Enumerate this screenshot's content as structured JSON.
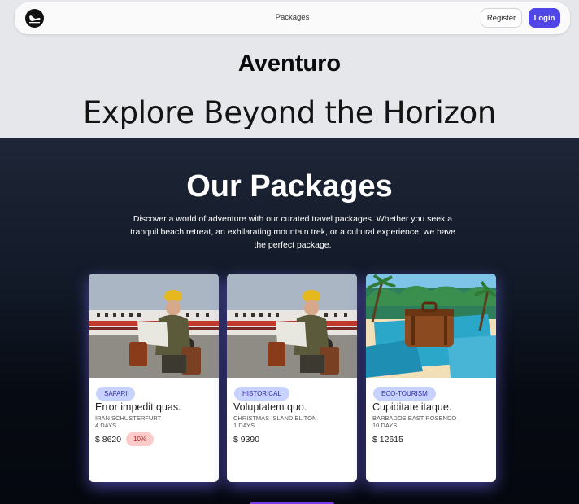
{
  "nav": {
    "center_link": "Packages",
    "register_label": "Register",
    "login_label": "Login",
    "logo_icon": "plane-landing-icon"
  },
  "hero": {
    "brand": "Aventuro",
    "tagline": "Explore Beyond the Horizon"
  },
  "packages_section": {
    "title": "Our Packages",
    "description": "Discover a world of adventure with our curated travel packages. Whether you seek a tranquil beach retreat, an exhilarating mountain trek, or a cultural experience, we have the perfect package.",
    "cards": [
      {
        "category": "Safari",
        "title": "Error impedit quas.",
        "location": "Iran Schusterfurt",
        "duration": "4 Days",
        "price": "$ 8620",
        "discount": "10%",
        "image": "traveler-airplane"
      },
      {
        "category": "Historical",
        "title": "Voluptatem quo.",
        "location": "Christmas Island Eliton",
        "duration": "1 Days",
        "price": "$ 9390",
        "image": "traveler-airplane"
      },
      {
        "category": "Eco-Tourism",
        "title": "Cupiditate itaque.",
        "location": "Barbados East Rosendo",
        "duration": "10 Days",
        "price": "$ 12615",
        "image": "suitcase-beach"
      }
    ]
  },
  "colors": {
    "accent": "#4f46e5",
    "badge_bg": "#c7d2fe",
    "discount_bg": "#fecaca"
  }
}
